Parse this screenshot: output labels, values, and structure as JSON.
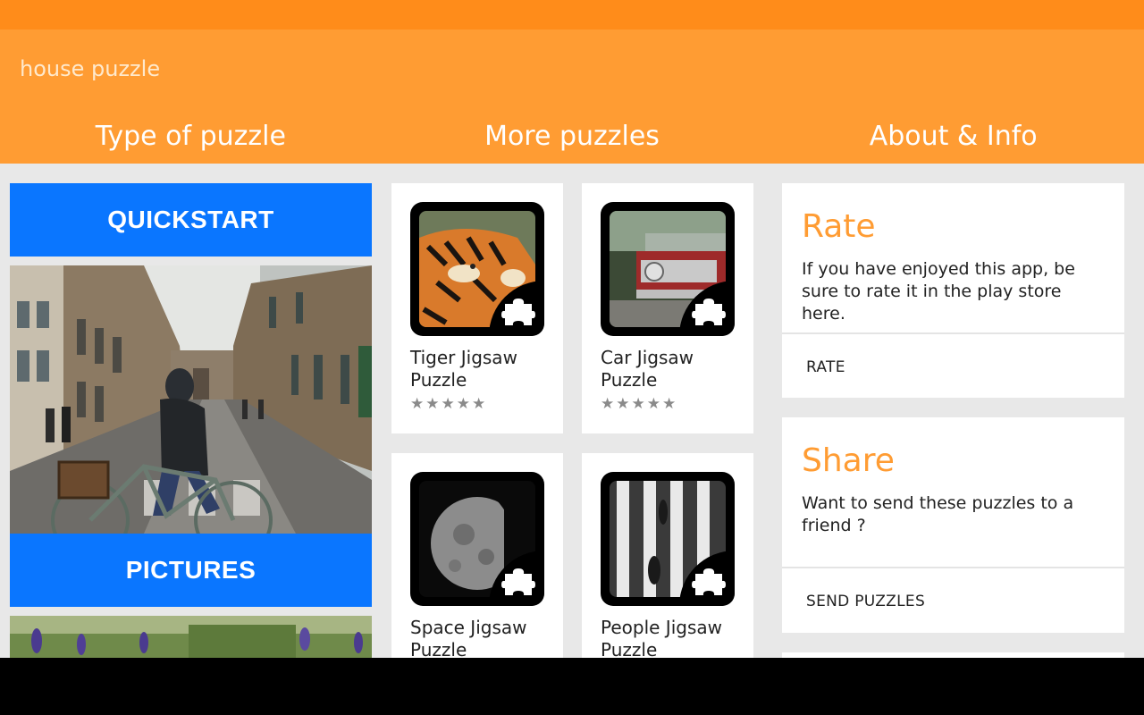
{
  "app": {
    "title": "house puzzle"
  },
  "tabs": [
    {
      "label": "Type of puzzle"
    },
    {
      "label": "More puzzles"
    },
    {
      "label": "About & Info"
    }
  ],
  "left_column": {
    "quickstart_label": "QUICKSTART",
    "pictures_label": "PICTURES"
  },
  "puzzles": [
    {
      "title": "Tiger Jigsaw Puzzle",
      "rating_stars": "★★★★★",
      "icon": "tiger-thumbnail"
    },
    {
      "title": "Car Jigsaw Puzzle",
      "rating_stars": "★★★★★",
      "icon": "car-thumbnail"
    },
    {
      "title": "Space Jigsaw Puzzle",
      "rating_stars": "",
      "icon": "moon-thumbnail"
    },
    {
      "title": "People Jigsaw Puzzle",
      "rating_stars": "",
      "icon": "people-thumbnail"
    }
  ],
  "info_cards": {
    "rate": {
      "title": "Rate",
      "body": "If you have enjoyed this app, be sure to rate it in the play store here.",
      "action": "RATE"
    },
    "share": {
      "title": "Share",
      "body": "Want to send these puzzles to a friend ?",
      "action": "SEND PUZZLES"
    }
  },
  "colors": {
    "status_bar": "#FF8C1A",
    "app_bar": "#FF9C33",
    "accent_blue": "#0A76FF",
    "info_title": "#FF9C33",
    "background": "#E8E8E8"
  }
}
